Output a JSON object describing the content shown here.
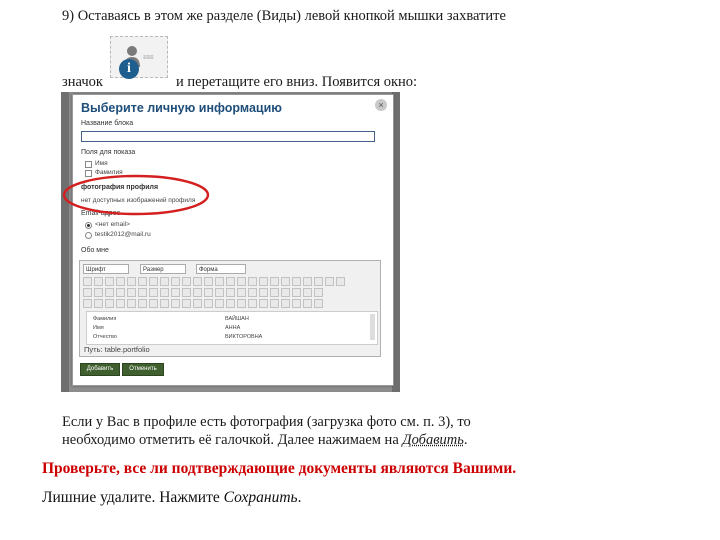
{
  "top": {
    "step_text": "9) Оставаясь в этом же разделе (Виды) левой кнопкой мышки захватите",
    "znachok": "значок",
    "drag_text": "и перетащите его вниз. Появится окно:"
  },
  "icon": {
    "semantic": "profile-info-icon",
    "glyph": "i"
  },
  "dialog": {
    "title": "Выберите личную информацию",
    "close_glyph": "×",
    "block_name_label": "Название блока",
    "fields_label": "Поля для показа",
    "field_options": [
      "Имя",
      "Фамилия"
    ],
    "photo_label": "фотография профиля",
    "photo_note": "нет доступных изображений профиля",
    "email_label": "Email-адрес",
    "email_options": [
      "<нет email>",
      "testik2012@mail.ru"
    ],
    "about_label": "Обо мне",
    "editor": {
      "font_select": "Шрифт",
      "size_select": "Размер",
      "format_select": "Форма",
      "table_rows": [
        [
          "Фамилия",
          "ВАЙШАН"
        ],
        [
          "Имя",
          "АННА"
        ],
        [
          "Отчество",
          "ВИКТОРОВНА"
        ]
      ],
      "path": "Путь: table.portfolio"
    },
    "add_button": "Добавить",
    "cancel_button": "Отменить"
  },
  "bottom": {
    "para_line1": "Если у Вас в профиле есть фотография (загрузка фото см. п. 3), то",
    "para_line2_a": "необходимо отметить её галочкой. Далее нажимаем на ",
    "para_line2_b": "Добавить",
    "para_line2_c": ".",
    "check_text": "Проверьте, все ли подтверждающие документы являются Вашими.",
    "remove_a": "Лишние удалите. Нажмите ",
    "remove_b": "Сохранить",
    "remove_c": "."
  },
  "colors": {
    "highlight_ellipse": "#d42020",
    "warning_text": "#cc0000",
    "dialog_title": "#1e4e7a",
    "button_green": "#3f5f2f"
  }
}
